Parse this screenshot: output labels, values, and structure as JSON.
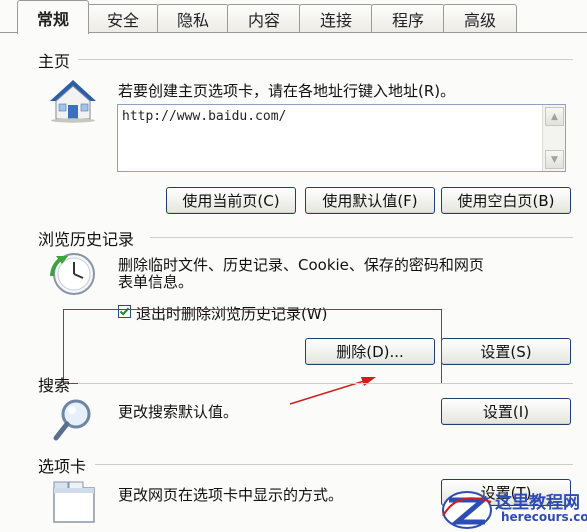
{
  "tabs": [
    {
      "label": "常规",
      "active": true
    },
    {
      "label": "安全"
    },
    {
      "label": "隐私"
    },
    {
      "label": "内容"
    },
    {
      "label": "连接"
    },
    {
      "label": "程序"
    },
    {
      "label": "高级"
    }
  ],
  "home": {
    "group_label": "主页",
    "description": "若要创建主页选项卡，请在各地址行键入地址(R)。",
    "address_value": "http://www.baidu.com/",
    "buttons": {
      "use_current": "使用当前页(C)",
      "use_default": "使用默认值(F)",
      "use_blank": "使用空白页(B)"
    }
  },
  "history": {
    "group_label": "浏览历史记录",
    "description_line1": "删除临时文件、历史记录、Cookie、保存的密码和网页",
    "description_line2": "表单信息。",
    "checkbox_label": "退出时删除浏览历史记录(W)",
    "checkbox_checked": true,
    "delete_button": "删除(D)...",
    "settings_button": "设置(S)"
  },
  "search": {
    "group_label": "搜索",
    "description": "更改搜索默认值。",
    "settings_button": "设置(I)"
  },
  "tabs_section": {
    "group_label": "选项卡",
    "description": "更改网页在选项卡中显示的方式。",
    "settings_button": "设置(T)"
  },
  "icons": {
    "home": "home-icon",
    "history": "history-clock-icon",
    "search": "search-magnifier-icon",
    "tabs": "tabs-window-icon"
  },
  "annotation_color": "#d21d1d",
  "watermark": {
    "name": "这里教程网",
    "site": "herecours.com"
  }
}
